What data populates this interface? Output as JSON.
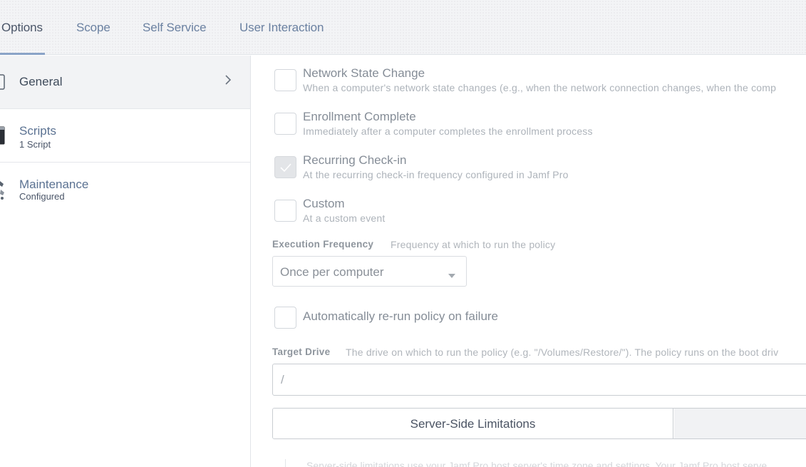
{
  "tabs": [
    {
      "label": "Options",
      "active": true
    },
    {
      "label": "Scope",
      "active": false
    },
    {
      "label": "Self Service",
      "active": false
    },
    {
      "label": "User Interaction",
      "active": false
    }
  ],
  "sidebar": {
    "items": [
      {
        "title": "General",
        "subtitle": "",
        "icon": "device-icon",
        "selected": true
      },
      {
        "title": "Scripts",
        "subtitle": "1 Script",
        "icon": "script-icon",
        "selected": false
      },
      {
        "title": "Maintenance",
        "subtitle": "Configured",
        "icon": "wrench-icon",
        "selected": false
      }
    ]
  },
  "triggers": [
    {
      "title": "Network State Change",
      "description": "When a computer's network state changes (e.g., when the network connection changes, when the comp",
      "checked": false
    },
    {
      "title": "Enrollment Complete",
      "description": "Immediately after a computer completes the enrollment process",
      "checked": false
    },
    {
      "title": "Recurring Check-in",
      "description": "At the recurring check-in frequency configured in Jamf Pro",
      "checked": true
    },
    {
      "title": "Custom",
      "description": "At a custom event",
      "checked": false
    }
  ],
  "execution_frequency": {
    "label": "Execution Frequency",
    "help": "Frequency at which to run the policy",
    "selected": "Once per computer"
  },
  "rerun": {
    "label": "Automatically re-run policy on failure",
    "checked": false
  },
  "target_drive": {
    "label": "Target Drive",
    "help": "The drive on which to run the policy (e.g. \"/Volumes/Restore/\"). The policy runs on the boot driv",
    "value": "/"
  },
  "limitations": {
    "server_side_label": "Server-Side Limitations",
    "note": "Server-side limitations use your Jamf Pro host server's time zone and settings. Your Jamf Pro host serve"
  },
  "colors": {
    "accent": "#8aa3c7",
    "tab_text": "#6b81a1"
  }
}
